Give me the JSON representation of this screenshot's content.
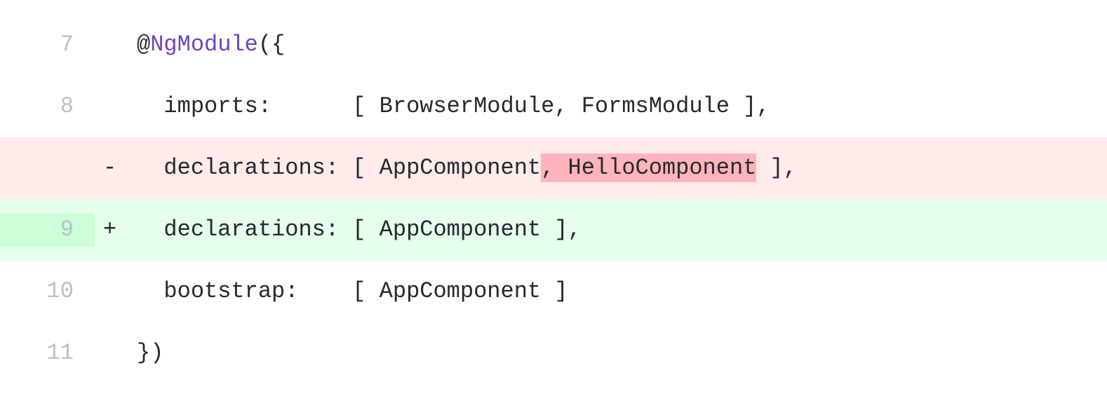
{
  "lines": [
    {
      "number": "7",
      "marker": "",
      "type": "context",
      "tokens": {
        "at": "@",
        "decorator": "NgModule",
        "open": "({"
      }
    },
    {
      "number": "8",
      "marker": "",
      "type": "context",
      "tokens": {
        "text": "  imports:      [ BrowserModule, FormsModule ],"
      }
    },
    {
      "number": "",
      "marker": "-",
      "type": "deleted",
      "tokens": {
        "prefix": "  declarations: [ AppComponent",
        "removed": ", HelloComponent",
        "suffix": " ],"
      }
    },
    {
      "number": "9",
      "marker": "+",
      "type": "added",
      "tokens": {
        "text": "  declarations: [ AppComponent ],"
      }
    },
    {
      "number": "10",
      "marker": "",
      "type": "context",
      "tokens": {
        "text": "  bootstrap:    [ AppComponent ]"
      }
    },
    {
      "number": "11",
      "marker": "",
      "type": "context",
      "tokens": {
        "text": "})"
      }
    }
  ]
}
